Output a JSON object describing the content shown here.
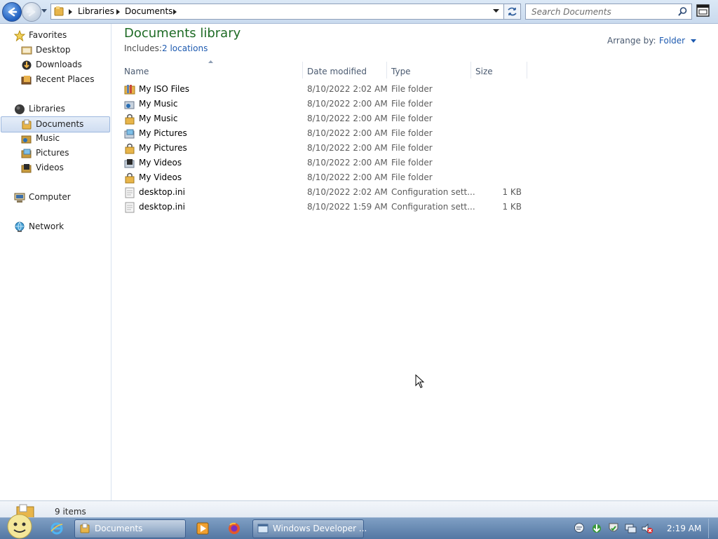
{
  "address": {
    "crumbs": [
      "Libraries",
      "Documents"
    ]
  },
  "search": {
    "placeholder": "Search Documents"
  },
  "nav": {
    "favorites_label": "Favorites",
    "favorites": [
      "Desktop",
      "Downloads",
      "Recent Places"
    ],
    "libraries_label": "Libraries",
    "libraries": [
      "Documents",
      "Music",
      "Pictures",
      "Videos"
    ],
    "computer_label": "Computer",
    "network_label": "Network",
    "selected": "Documents"
  },
  "library": {
    "title": "Documents library",
    "includes_label": "Includes:",
    "includes_link": "2 locations",
    "arrange_label": "Arrange by:",
    "arrange_value": "Folder"
  },
  "columns": {
    "name": "Name",
    "date": "Date modified",
    "type": "Type",
    "size": "Size"
  },
  "files": [
    {
      "name": "My ISO Files",
      "date": "8/10/2022 2:02 AM",
      "type": "File folder",
      "size": "",
      "icon": "folder-icon"
    },
    {
      "name": "My Music",
      "date": "8/10/2022 2:00 AM",
      "type": "File folder",
      "size": "",
      "icon": "music-folder-icon"
    },
    {
      "name": "My Music",
      "date": "8/10/2022 2:00 AM",
      "type": "File folder",
      "size": "",
      "icon": "locked-folder-icon"
    },
    {
      "name": "My Pictures",
      "date": "8/10/2022 2:00 AM",
      "type": "File folder",
      "size": "",
      "icon": "pictures-folder-icon"
    },
    {
      "name": "My Pictures",
      "date": "8/10/2022 2:00 AM",
      "type": "File folder",
      "size": "",
      "icon": "locked-folder-icon"
    },
    {
      "name": "My Videos",
      "date": "8/10/2022 2:00 AM",
      "type": "File folder",
      "size": "",
      "icon": "videos-folder-icon"
    },
    {
      "name": "My Videos",
      "date": "8/10/2022 2:00 AM",
      "type": "File folder",
      "size": "",
      "icon": "locked-folder-icon"
    },
    {
      "name": "desktop.ini",
      "date": "8/10/2022 2:02 AM",
      "type": "Configuration sett...",
      "size": "1 KB",
      "icon": "config-file-icon"
    },
    {
      "name": "desktop.ini",
      "date": "8/10/2022 1:59 AM",
      "type": "Configuration sett...",
      "size": "1 KB",
      "icon": "config-file-icon"
    }
  ],
  "status": {
    "count": "9 items"
  },
  "taskbar": {
    "documents_label": "Documents",
    "windows_dev_label": "Windows Developer ...",
    "clock": "2:19 AM"
  },
  "colors": {
    "library_title": "#1e6b25",
    "link": "#1d5ab0",
    "taskbar": "#5477a3"
  }
}
